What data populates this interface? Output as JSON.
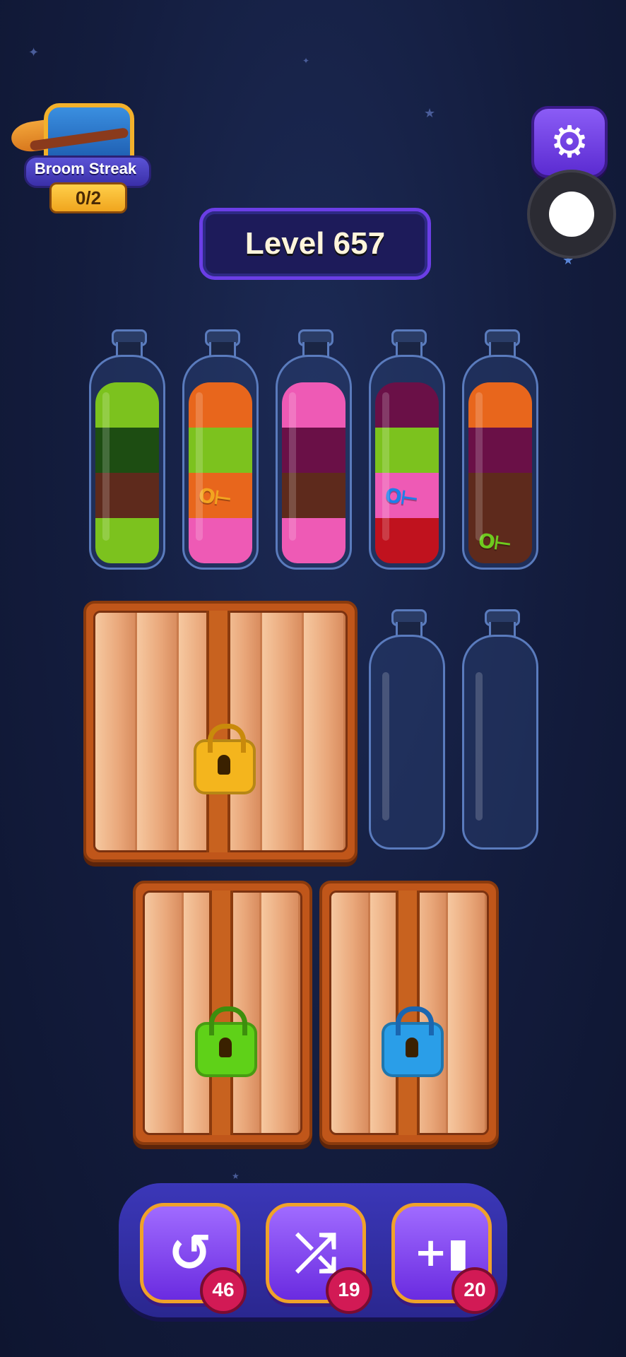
{
  "broom_streak": {
    "label": "Broom Streak",
    "count": "0/2"
  },
  "level": {
    "label": "Level 657"
  },
  "colors": {
    "lime": "#7cc21e",
    "dark_green": "#1d4d12",
    "brown": "#5e2a1c",
    "orange": "#e8661c",
    "pink": "#ee5ab5",
    "purple": "#6a1047",
    "red": "#c0121e"
  },
  "bottles": [
    {
      "layers": [
        "lime",
        "brown",
        "dark_green",
        "lime"
      ],
      "key": null
    },
    {
      "layers": [
        "pink",
        "orange",
        "lime",
        "orange"
      ],
      "key": {
        "color": "#f2a420",
        "layer": 1
      }
    },
    {
      "layers": [
        "pink",
        "brown",
        "purple",
        "pink"
      ],
      "key": null
    },
    {
      "layers": [
        "red",
        "pink",
        "lime",
        "purple"
      ],
      "key": {
        "color": "#1e7fe8",
        "layer": 1
      }
    },
    {
      "layers": [
        "brown",
        "brown",
        "purple",
        "orange"
      ],
      "key": {
        "color": "#6ec91e",
        "layer": 0
      }
    },
    {
      "layers": [],
      "key": null
    },
    {
      "layers": [],
      "key": null
    }
  ],
  "locks": [
    {
      "color": "gold",
      "hex": "#f4b51d"
    },
    {
      "color": "green",
      "hex": "#5fd118"
    },
    {
      "color": "blue",
      "hex": "#2a9ee8"
    }
  ],
  "powerups": [
    {
      "name": "undo",
      "icon": "undo-icon",
      "count": "46"
    },
    {
      "name": "shuffle",
      "icon": "shuffle-icon",
      "count": "19"
    },
    {
      "name": "add-bottle",
      "icon": "add-bottle-icon",
      "count": "20"
    }
  ]
}
